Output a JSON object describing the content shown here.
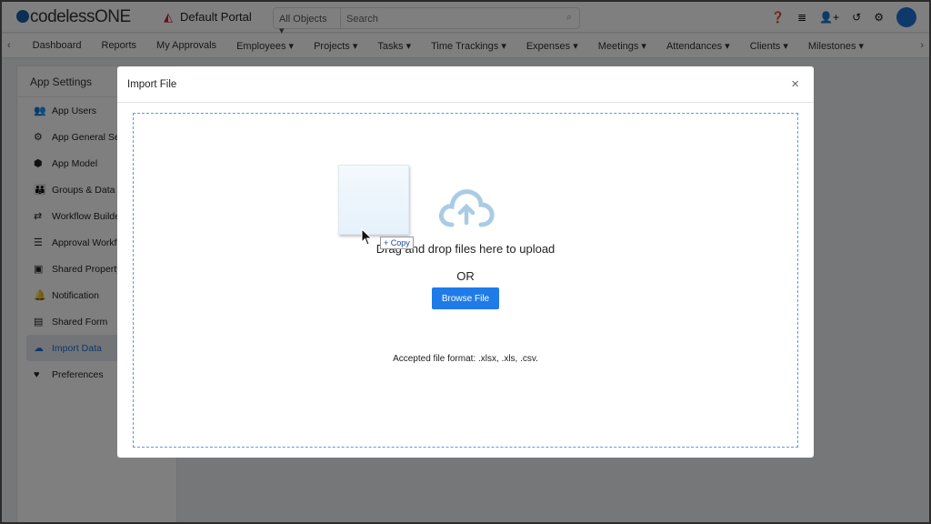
{
  "header": {
    "logo": "codelessONE",
    "portal": "Default Portal",
    "search_scope": "All Objects",
    "search_placeholder": "Search",
    "icons": [
      "help-icon",
      "database-icon",
      "add-user-icon",
      "history-icon",
      "gear-icon",
      "user-avatar-icon"
    ]
  },
  "nav": {
    "items": [
      "Dashboard",
      "Reports",
      "My Approvals",
      "Employees ▾",
      "Projects ▾",
      "Tasks ▾",
      "Time Trackings ▾",
      "Expenses ▾",
      "Meetings ▾",
      "Attendances ▾",
      "Clients ▾",
      "Milestones ▾"
    ]
  },
  "sidebar": {
    "title": "App Settings",
    "items": [
      {
        "label": "App Users",
        "icon": "👥"
      },
      {
        "label": "App General Settings",
        "icon": "⚙"
      },
      {
        "label": "App Model",
        "icon": "⬢"
      },
      {
        "label": "Groups & Data Access",
        "icon": "👪"
      },
      {
        "label": "Workflow Builder",
        "icon": "⇄"
      },
      {
        "label": "Approval Workflow",
        "icon": "☰"
      },
      {
        "label": "Shared Property",
        "icon": "▣"
      },
      {
        "label": "Notification",
        "icon": "🔔"
      },
      {
        "label": "Shared Form",
        "icon": "▤"
      },
      {
        "label": "Import Data",
        "icon": "☁",
        "active": true
      },
      {
        "label": "Preferences",
        "icon": "♥"
      }
    ]
  },
  "modal": {
    "title": "Import File",
    "close": "×",
    "drop_text": "Drag and drop files here to upload",
    "or": "OR",
    "browse": "Browse File",
    "accepted": "Accepted file format: .xlsx, .xls, .csv.",
    "drag_badge": "+ Copy"
  },
  "colors": {
    "accent": "#1e7be8",
    "cloud": "#a9cbe6"
  }
}
